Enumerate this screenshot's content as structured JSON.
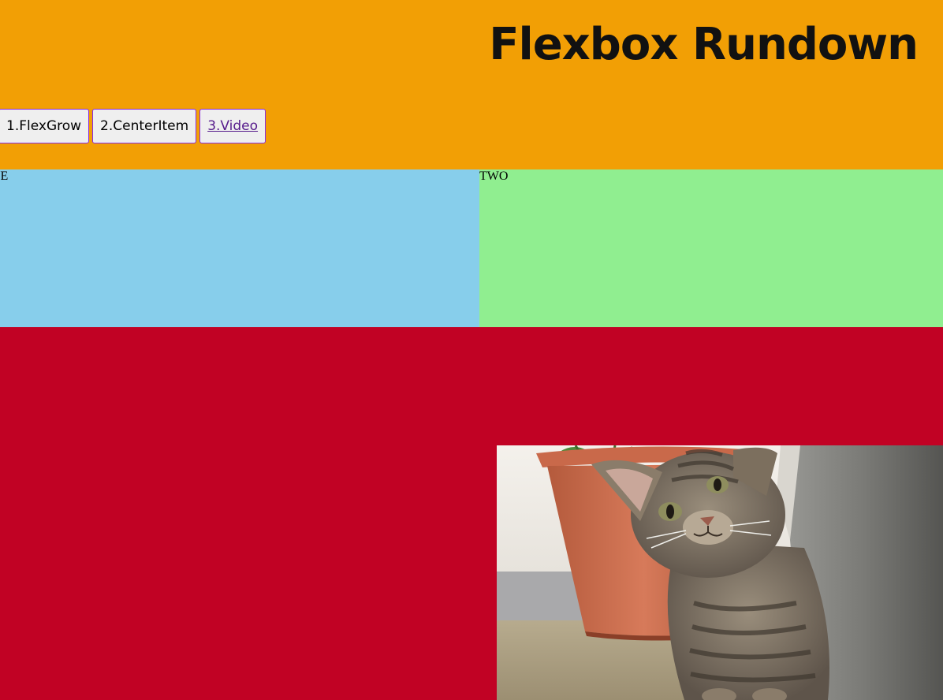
{
  "header": {
    "title": "Flexbox Rundown",
    "background": "#f29f05"
  },
  "nav": {
    "items": [
      {
        "label": "1.FlexGrow"
      },
      {
        "label": "2.CenterItem"
      },
      {
        "label": "3.Video",
        "is_link": true
      }
    ]
  },
  "boxes": {
    "one": {
      "label": "NE",
      "color": "#87ceeb"
    },
    "two": {
      "label": "TWO",
      "color": "#90ee90"
    }
  },
  "video_section": {
    "background": "#c10224",
    "image_icon": "kitten-photo"
  }
}
